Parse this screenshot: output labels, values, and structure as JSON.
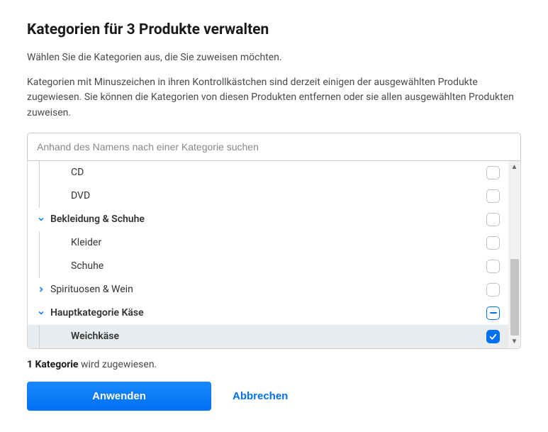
{
  "title": "Kategorien für 3 Produkte verwalten",
  "subtitle": "Wählen Sie die Kategorien aus, die Sie zuweisen möchten.",
  "description": "Kategorien mit Minuszeichen in ihren Kontrollkästchen sind derzeit einigen der ausgewählten Produkte zugewiesen. Sie können die Kategorien von diesen Produkten entfernen oder sie allen ausgewählten Produkten zuweisen.",
  "search": {
    "placeholder": "Anhand des Namens nach einer Kategorie suchen"
  },
  "tree": {
    "items": [
      {
        "label": "CD",
        "depth": 2,
        "chevron": "none",
        "state": "unchecked",
        "bold": false
      },
      {
        "label": "DVD",
        "depth": 2,
        "chevron": "none",
        "state": "unchecked",
        "bold": false
      },
      {
        "label": "Bekleidung & Schuhe",
        "depth": 1,
        "chevron": "down",
        "state": "unchecked",
        "bold": true
      },
      {
        "label": "Kleider",
        "depth": 2,
        "chevron": "none",
        "state": "unchecked",
        "bold": false
      },
      {
        "label": "Schuhe",
        "depth": 2,
        "chevron": "none",
        "state": "unchecked",
        "bold": false
      },
      {
        "label": "Spirituosen & Wein",
        "depth": 1,
        "chevron": "right",
        "state": "unchecked",
        "bold": false
      },
      {
        "label": "Hauptkategorie Käse",
        "depth": 1,
        "chevron": "down",
        "state": "indeterminate",
        "bold": true
      },
      {
        "label": "Weichkäse",
        "depth": 2,
        "chevron": "none",
        "state": "checked",
        "bold": true,
        "selected": true
      }
    ]
  },
  "status": {
    "bold": "1 Kategorie",
    "rest": " wird zugewiesen."
  },
  "actions": {
    "apply": "Anwenden",
    "cancel": "Abbrechen"
  }
}
